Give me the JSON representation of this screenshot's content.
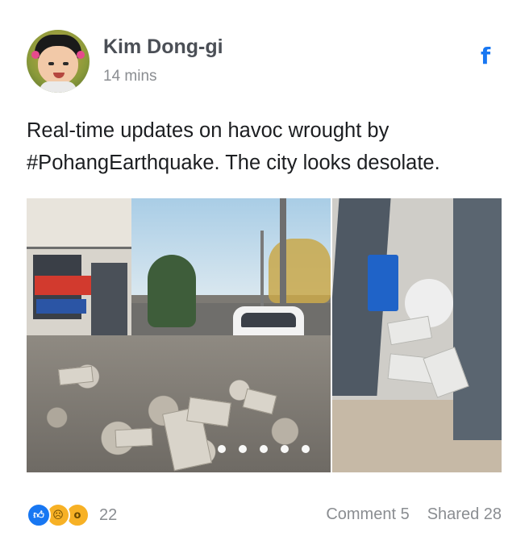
{
  "post": {
    "author": "Kim Dong-gi",
    "timestamp": "14 mins",
    "text": "Real-time updates on havoc wrought by #PohangEarthquake. The city looks desolate.",
    "platform_icon": "facebook-icon"
  },
  "media": {
    "carousel_total": 5,
    "carousel_active_index": 0
  },
  "footer": {
    "reaction_icons": [
      "like-icon",
      "sad-icon",
      "wow-icon"
    ],
    "reaction_count": "22",
    "comment_label": "Comment 5",
    "shared_label": "Shared 28"
  },
  "colors": {
    "accent": "#1877f2",
    "muted_text": "#8a8d91",
    "name_text": "#4b4f56"
  }
}
